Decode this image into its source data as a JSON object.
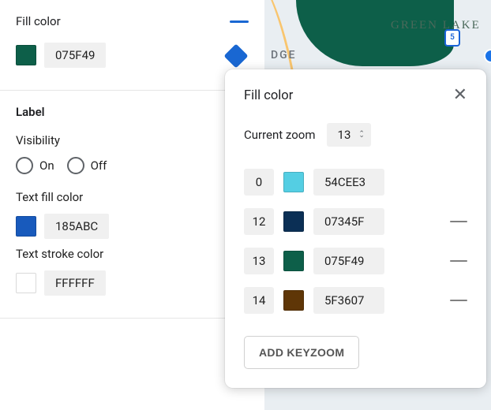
{
  "left": {
    "fill_color": {
      "label": "Fill color",
      "hex": "075F49",
      "swatch": "#0d5f49"
    },
    "label_section": {
      "title": "Label",
      "visibility_label": "Visibility",
      "on": "On",
      "off": "Off",
      "text_fill_label": "Text fill color",
      "text_fill_hex": "185ABC",
      "text_fill_swatch": "#185abc",
      "text_stroke_label": "Text stroke color",
      "text_stroke_hex": "FFFFFF",
      "text_stroke_swatch": "#ffffff"
    }
  },
  "map": {
    "lake_label": "GREEN LAKE",
    "dge_label": "DGE",
    "shield": "5"
  },
  "popover": {
    "title": "Fill color",
    "zoom_label": "Current zoom",
    "zoom_value": "13",
    "stops": [
      {
        "zoom": "0",
        "hex": "54CEE3",
        "swatch": "#54cee3",
        "removable": false
      },
      {
        "zoom": "12",
        "hex": "07345F",
        "swatch": "#0b2f55",
        "removable": true
      },
      {
        "zoom": "13",
        "hex": "075F49",
        "swatch": "#0d5f49",
        "removable": true
      },
      {
        "zoom": "14",
        "hex": "5F3607",
        "swatch": "#5f3607",
        "removable": true
      }
    ],
    "add_label": "ADD KEYZOOM"
  }
}
